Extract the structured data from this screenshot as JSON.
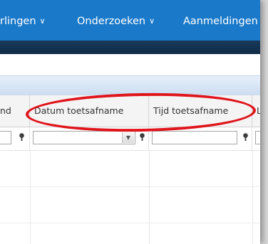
{
  "nav": {
    "items": [
      {
        "label": "rlingen",
        "chevron": "chevron-down"
      },
      {
        "label": "Onderzoeken",
        "chevron": "chevron-down"
      },
      {
        "label": "Aanmeldingen",
        "chevron": ""
      }
    ]
  },
  "grid": {
    "columns": [
      {
        "label": "nd"
      },
      {
        "label": "Datum toetsafname"
      },
      {
        "label": "Tijd toetsafname"
      },
      {
        "label": "L"
      }
    ]
  },
  "colors": {
    "nav_bg": "#1a79c9",
    "nav_dark": "#0f2a47",
    "highlight": "#e0141b"
  },
  "icons": [
    "chevron-down-icon",
    "filter-icon",
    "dropdown-arrow-icon"
  ]
}
